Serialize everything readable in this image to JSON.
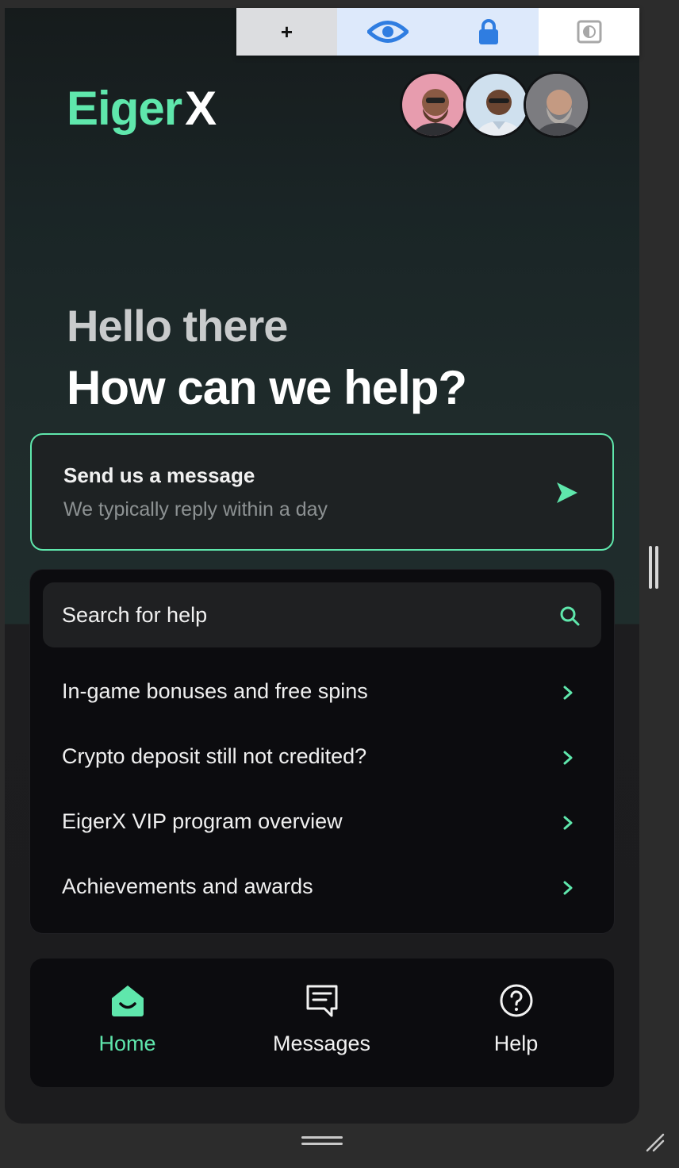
{
  "toolbar": {
    "buttons": [
      {
        "name": "add",
        "icon": "plus-icon",
        "label": "+"
      },
      {
        "name": "preview",
        "icon": "eye-icon"
      },
      {
        "name": "lock",
        "icon": "lock-icon"
      },
      {
        "name": "contrast",
        "icon": "contrast-icon"
      }
    ]
  },
  "brand": {
    "name_part1": "Eiger",
    "name_part2": "X",
    "accent_color": "#5fe7ac"
  },
  "team_avatars": [
    "avatar-1",
    "avatar-2",
    "avatar-3"
  ],
  "greeting": {
    "line1": "Hello there",
    "line2": "How can we help?"
  },
  "message_card": {
    "title": "Send us a message",
    "subtitle": "We typically reply within a day",
    "icon": "send-icon"
  },
  "search": {
    "placeholder": "Search for help",
    "icon": "search-icon"
  },
  "help_articles": [
    {
      "label": "In-game bonuses and free spins"
    },
    {
      "label": "Crypto deposit still not credited?"
    },
    {
      "label": "EigerX VIP program overview"
    },
    {
      "label": "Achievements and awards"
    }
  ],
  "nav": {
    "items": [
      {
        "label": "Home",
        "icon": "home-icon",
        "active": true
      },
      {
        "label": "Messages",
        "icon": "messages-icon",
        "active": false
      },
      {
        "label": "Help",
        "icon": "help-icon",
        "active": false
      }
    ]
  },
  "colors": {
    "accent": "#5fe7ac",
    "card_bg": "#0c0c0f",
    "text": "#f0f0f0"
  }
}
